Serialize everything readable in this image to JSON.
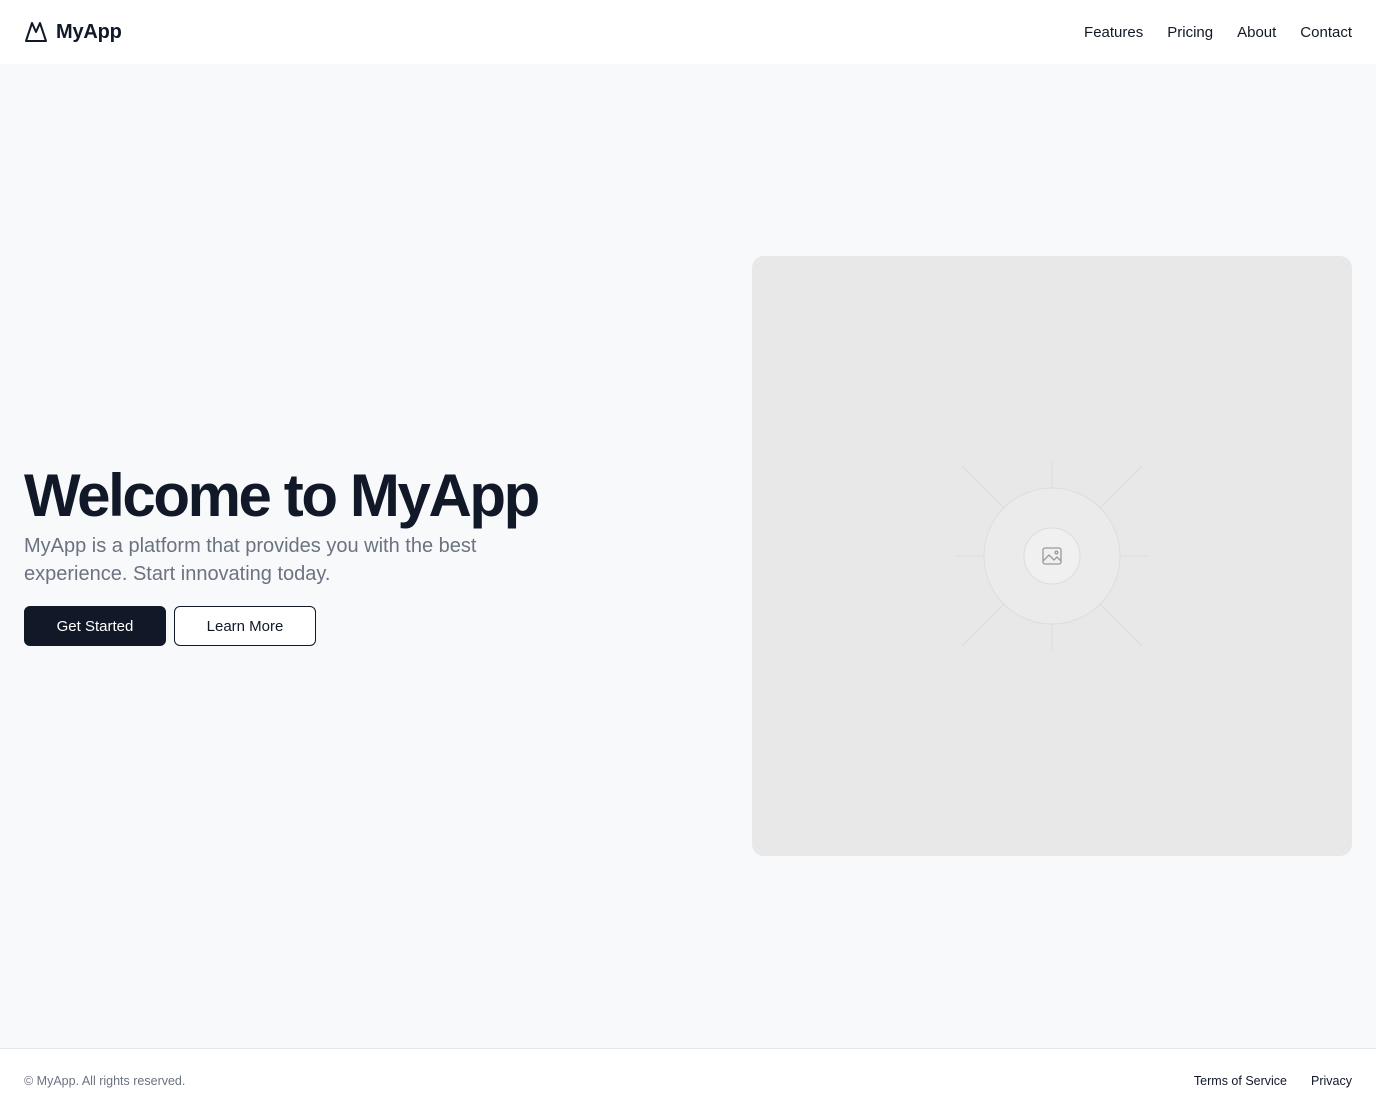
{
  "header": {
    "brand_icon": "mountain-logo-icon",
    "brand_name": "MyApp",
    "nav": [
      {
        "label": "Features"
      },
      {
        "label": "Pricing"
      },
      {
        "label": "About"
      },
      {
        "label": "Contact"
      }
    ]
  },
  "hero": {
    "title": "Welcome to MyApp",
    "subtitle": "MyApp is a platform that provides you with the best experience. Start innovating today.",
    "primary_button": "Get Started",
    "secondary_button": "Learn More",
    "image_icon": "image-placeholder-icon"
  },
  "footer": {
    "copyright": "© MyApp. All rights reserved.",
    "links": [
      {
        "label": "Terms of Service"
      },
      {
        "label": "Privacy"
      }
    ]
  },
  "colors": {
    "background": "#f8f9fa",
    "primary": "#111827",
    "muted_text": "#6b7280",
    "placeholder": "#e8e8e8"
  }
}
